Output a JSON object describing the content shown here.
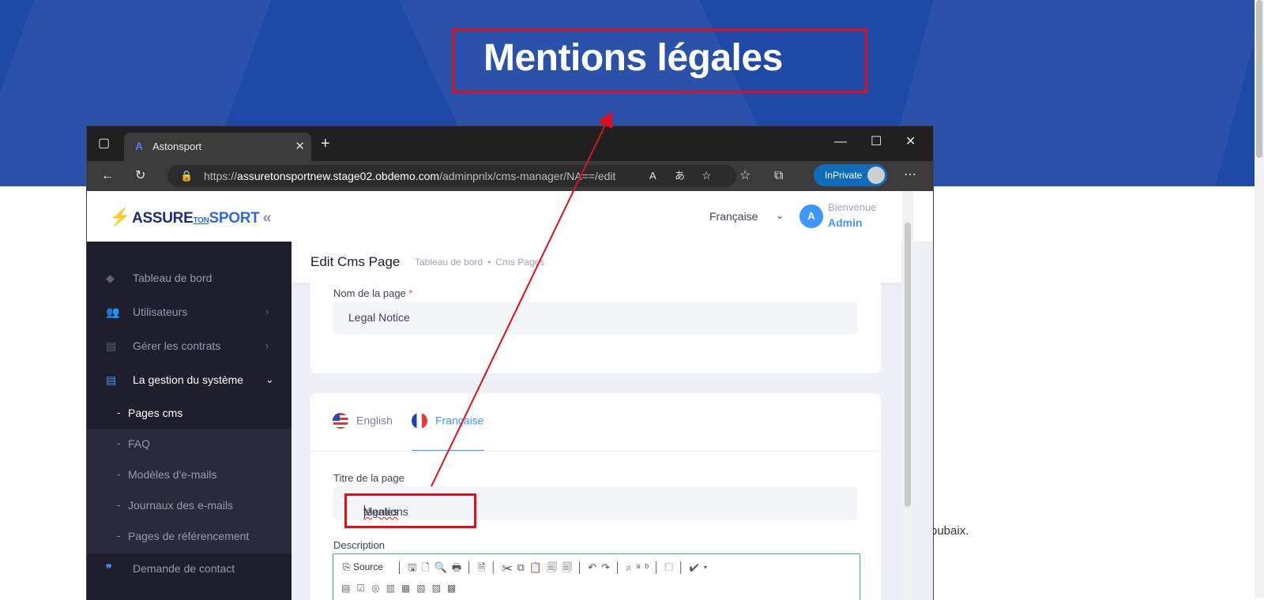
{
  "hero": {
    "title": "Mentions légales"
  },
  "background_text": "oubaix.",
  "browser": {
    "tab_title": "Astonsport",
    "tab_favicon": "A",
    "url_scheme": "https://",
    "url_host": "assuretonsportnew.stage02.obdemo.com",
    "url_path": "/adminpnlx/cms-manager/NA==/edit",
    "inprivate_label": "InPrivate"
  },
  "app": {
    "logo": {
      "part1": "ASSURE",
      "part2": "TON",
      "part3": "SPORT"
    },
    "language": "Française",
    "user": {
      "initial": "A",
      "greeting": "Bienvenue",
      "name": "Admin"
    },
    "sidebar": {
      "items": [
        {
          "label": "Tableau de bord",
          "icon": "layers-icon"
        },
        {
          "label": "Utilisateurs",
          "icon": "users-icon"
        },
        {
          "label": "Gérer les contrats",
          "icon": "archive-icon"
        },
        {
          "label": "La gestion du système",
          "icon": "server-icon"
        }
      ],
      "sub_items": [
        {
          "label": "Pages cms"
        },
        {
          "label": "FAQ"
        },
        {
          "label": "Modèles d'e-mails"
        },
        {
          "label": "Journaux des e-mails"
        },
        {
          "label": "Pages de référencement"
        }
      ],
      "contact": {
        "label": "Demande de contact",
        "icon": "quote-icon"
      }
    },
    "toolbar": {
      "title": "Edit Cms Page",
      "breadcrumbs": [
        "Tableau de bord",
        "Cms Pages"
      ]
    },
    "form": {
      "page_name_label": "Nom de la page",
      "page_name_required": "*",
      "page_name_value": "Legal Notice",
      "lang_tabs": [
        {
          "label": "English"
        },
        {
          "label": "Française"
        }
      ],
      "title_label": "Titre de la page",
      "title_value_part1": "Mentions ",
      "title_value_part2": "légales",
      "title_value_part3": " t",
      "description_label": "Description",
      "editor_source_label": "Source"
    }
  },
  "colors": {
    "hero_bg": "#1f49a6",
    "sidebar_bg": "#1e1e2d",
    "accent": "#3e97ff",
    "annotation": "#e0101a"
  }
}
